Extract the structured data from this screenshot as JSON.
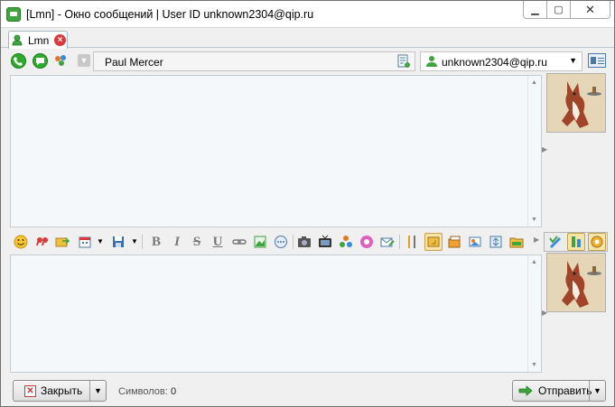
{
  "window": {
    "title": "[Lmn] - Окно сообщений | User ID unknown2304@qip.ru",
    "controls": {
      "minimize": "▁",
      "maximize": "▢",
      "close": "✕"
    }
  },
  "tab": {
    "label": "Lmn",
    "close_glyph": "×"
  },
  "contact": {
    "nickname": "Paul Mercer",
    "account": "unknown2304@qip.ru",
    "dropdown_glyph": "▼"
  },
  "format_toolbar": {
    "bold": "B",
    "italic": "I",
    "strike": "S",
    "underline": "U"
  },
  "bottom": {
    "close_label": "Закрыть",
    "counter_label": "Символов:",
    "counter_value": "0",
    "send_label": "Отправить"
  },
  "colors": {
    "accent_green": "#2faa2f",
    "close_red": "#d93a3a",
    "pane_bg": "#f4f8fb",
    "window_bg": "#f0f0f0"
  }
}
